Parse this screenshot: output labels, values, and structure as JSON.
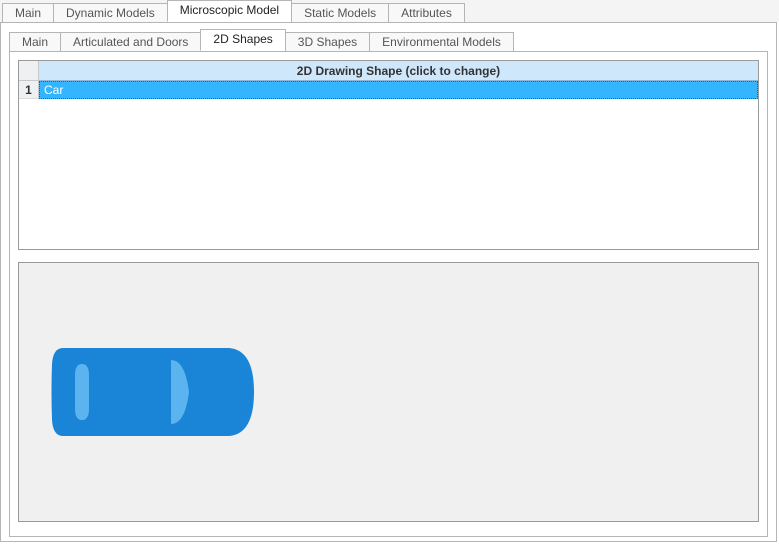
{
  "outer_tabs": {
    "items": [
      {
        "label": "Main"
      },
      {
        "label": "Dynamic Models"
      },
      {
        "label": "Microscopic Model"
      },
      {
        "label": "Static Models"
      },
      {
        "label": "Attributes"
      }
    ],
    "active_index": 2
  },
  "inner_tabs": {
    "items": [
      {
        "label": "Main"
      },
      {
        "label": "Articulated and Doors"
      },
      {
        "label": "2D Shapes"
      },
      {
        "label": "3D Shapes"
      },
      {
        "label": "Environmental Models"
      }
    ],
    "active_index": 2
  },
  "grid": {
    "column_header": "2D Drawing Shape (click to change)",
    "rows": [
      {
        "num": "1",
        "value": "Car"
      }
    ]
  },
  "preview": {
    "shape_name": "Car",
    "body_color": "#1a85d6",
    "window_color": "#5bb3ef"
  }
}
